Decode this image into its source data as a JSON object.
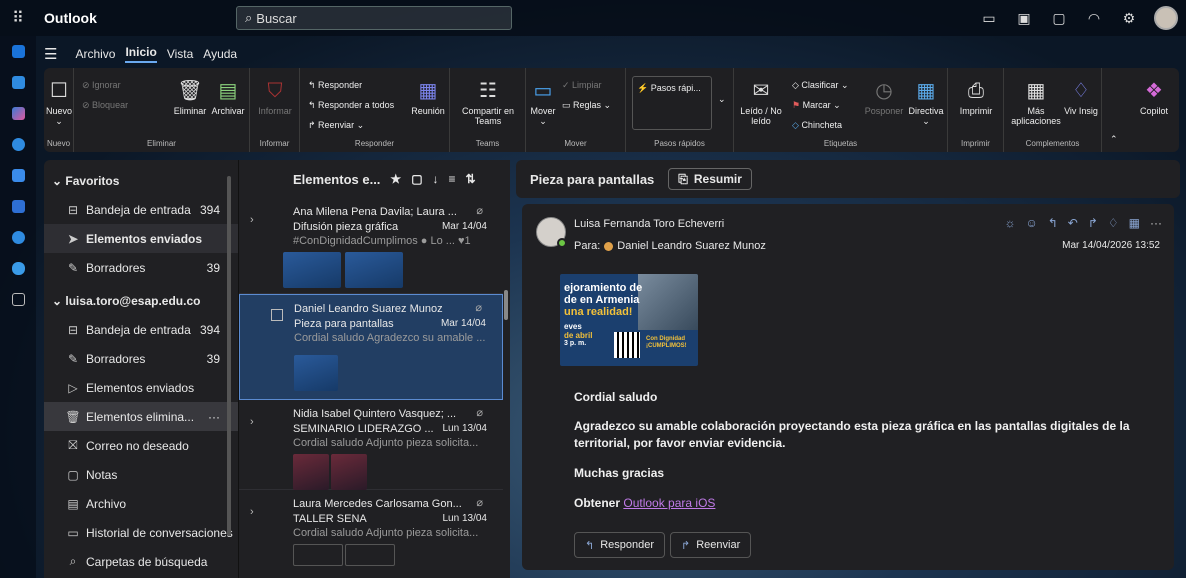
{
  "app": {
    "name": "Outlook",
    "search_placeholder": "Buscar"
  },
  "menu": {
    "items": [
      "Archivo",
      "Inicio",
      "Vista",
      "Ayuda"
    ],
    "active": "Inicio"
  },
  "ribbon": {
    "nuevo": {
      "label": "Nuevo",
      "foot": "Nuevo"
    },
    "eliminar": {
      "ignorar": "Ignorar",
      "bloquear": "Bloquear",
      "eliminar": "Eliminar",
      "archivar": "Archivar",
      "foot": "Eliminar"
    },
    "informar": {
      "label": "Informar",
      "foot": "Informar"
    },
    "responder": {
      "responder": "Responder",
      "responder_todos": "Responder a todos",
      "reenviar": "Reenviar",
      "reunion": "Reunión",
      "foot": "Responder"
    },
    "teams": {
      "label": "Compartir en Teams",
      "foot": "Teams"
    },
    "mover": {
      "mover": "Mover",
      "limpiar": "Limpiar",
      "reglas": "Reglas",
      "foot": "Mover"
    },
    "pasos": {
      "label": "Pasos rápi...",
      "foot": "Pasos rápidos"
    },
    "etiquetas": {
      "leido": "Leído / No leído",
      "clasificar": "Clasificar",
      "marcar": "Marcar",
      "chincheta": "Chincheta",
      "posponer": "Posponer",
      "directiva": "Directiva",
      "foot": "Etiquetas"
    },
    "imprimir": {
      "label": "Imprimir",
      "foot": "Imprimir"
    },
    "complementos": {
      "mas": "Más aplicaciones",
      "insig": "Viv Insig",
      "foot": "Complementos"
    },
    "copilot": "Copilot"
  },
  "folders": {
    "favoritos": "Favoritos",
    "fav_items": [
      {
        "label": "Bandeja de entrada",
        "count": "394"
      },
      {
        "label": "Elementos enviados",
        "count": ""
      },
      {
        "label": "Borradores",
        "count": "39"
      }
    ],
    "account": "luisa.toro@esap.edu.co",
    "acc_items": [
      {
        "label": "Bandeja de entrada",
        "count": "394"
      },
      {
        "label": "Borradores",
        "count": "39"
      },
      {
        "label": "Elementos enviados",
        "count": ""
      },
      {
        "label": "Elementos elimina...",
        "count": "···"
      },
      {
        "label": "Correo no deseado",
        "count": ""
      },
      {
        "label": "Notas",
        "count": ""
      },
      {
        "label": "Archivo",
        "count": ""
      },
      {
        "label": "Historial de conversaciones",
        "count": ""
      },
      {
        "label": "Carpetas de búsqueda",
        "count": ""
      }
    ]
  },
  "list": {
    "title": "Elementos e...",
    "messages": [
      {
        "from": "Ana Milena Pena Davila; Laura ...",
        "subject": "Difusión pieza gráfica",
        "date": "Mar 14/04",
        "preview": "#ConDignidadCumplimos ● Lo ... ♥1"
      },
      {
        "from": "Daniel Leandro Suarez Munoz",
        "subject": "Pieza para pantallas",
        "date": "Mar 14/04",
        "preview": "Cordial saludo Agradezco su amable ..."
      },
      {
        "from": "Nidia Isabel Quintero Vasquez; ...",
        "subject": "SEMINARIO LIDERAZGO ...",
        "date": "Lun 13/04",
        "preview": "Cordial saludo Adjunto pieza solicita..."
      },
      {
        "from": "Laura Mercedes Carlosama Gon...",
        "subject": "TALLER SENA",
        "date": "Lun 13/04",
        "preview": "Cordial saludo Adjunto pieza solicita..."
      }
    ]
  },
  "reading": {
    "subject": "Pieza para pantallas",
    "summarize": "Resumir",
    "sender": "Luisa Fernanda Toro Echeverri",
    "to_label": "Para:",
    "to": "Daniel Leandro Suarez Munoz",
    "date": "Mar 14/04/2026 13:52",
    "poster_lines": [
      "ejoramiento de",
      "de en Armenia",
      "una realidad!"
    ],
    "poster_small": [
      "eves",
      "de abril",
      "3 p. m."
    ],
    "poster_tag": "Con Dignidad ¡CUMPLIMOS!",
    "greeting": "Cordial saludo",
    "body": "Agradezco su amable colaboración proyectando esta pieza gráfica en las pantallas digitales de la territorial, por favor enviar evidencia.",
    "thanks": "Muchas gracias",
    "get": "Obtener",
    "link": "Outlook para iOS",
    "reply": "Responder",
    "forward": "Reenviar"
  }
}
